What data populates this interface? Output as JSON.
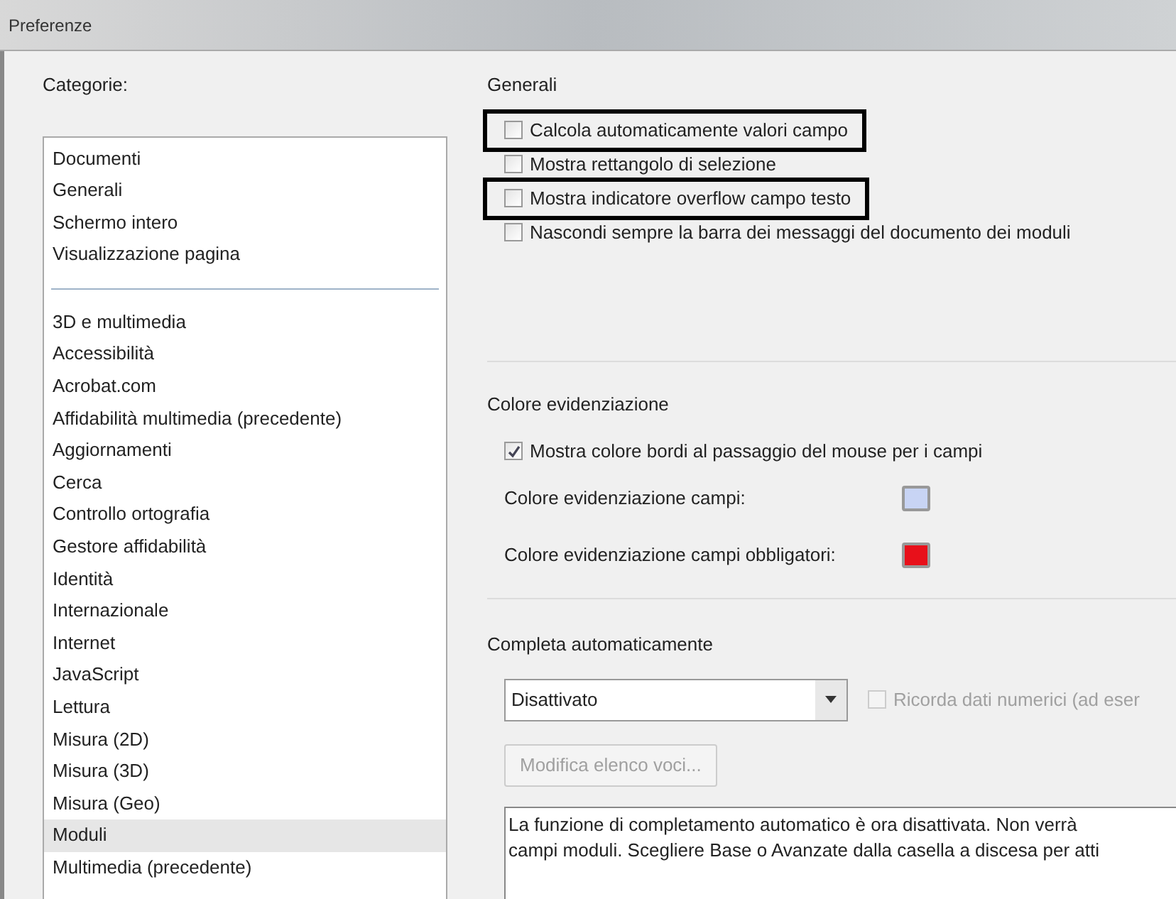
{
  "window": {
    "title": "Preferenze"
  },
  "categories": {
    "label": "Categorie:",
    "groups": [
      [
        {
          "label": "Documenti",
          "selected": false
        },
        {
          "label": "Generali",
          "selected": false
        },
        {
          "label": "Schermo intero",
          "selected": false
        },
        {
          "label": "Visualizzazione pagina",
          "selected": false
        }
      ],
      [
        {
          "label": "3D e multimedia",
          "selected": false
        },
        {
          "label": "Accessibilità",
          "selected": false
        },
        {
          "label": "Acrobat.com",
          "selected": false
        },
        {
          "label": "Affidabilità multimedia (precedente)",
          "selected": false
        },
        {
          "label": "Aggiornamenti",
          "selected": false
        },
        {
          "label": "Cerca",
          "selected": false
        },
        {
          "label": "Controllo ortografia",
          "selected": false
        },
        {
          "label": "Gestore affidabilità",
          "selected": false
        },
        {
          "label": "Identità",
          "selected": false
        },
        {
          "label": "Internazionale",
          "selected": false
        },
        {
          "label": "Internet",
          "selected": false
        },
        {
          "label": "JavaScript",
          "selected": false
        },
        {
          "label": "Lettura",
          "selected": false
        },
        {
          "label": "Misura (2D)",
          "selected": false
        },
        {
          "label": "Misura (3D)",
          "selected": false
        },
        {
          "label": "Misura (Geo)",
          "selected": false
        },
        {
          "label": "Moduli",
          "selected": true
        },
        {
          "label": "Multimedia (precedente)",
          "selected": false
        }
      ]
    ]
  },
  "general": {
    "title": "Generali",
    "options": [
      {
        "label": "Calcola automaticamente valori campo",
        "checked": false,
        "highlighted": true
      },
      {
        "label": "Mostra rettangolo di selezione",
        "checked": false,
        "highlighted": false
      },
      {
        "label": "Mostra indicatore overflow campo testo",
        "checked": false,
        "highlighted": true
      },
      {
        "label": "Nascondi sempre la barra dei messaggi del documento dei moduli",
        "checked": false,
        "highlighted": false
      }
    ]
  },
  "highlight": {
    "title": "Colore evidenziazione",
    "option": {
      "label": "Mostra colore bordi al passaggio del mouse per i campi",
      "checked": true
    },
    "colors": [
      {
        "label": "Colore evidenziazione campi:",
        "color": "#c8d4f4"
      },
      {
        "label": "Colore evidenziazione campi obbligatori:",
        "color": "#e8101a"
      }
    ]
  },
  "autocomplete": {
    "title": "Completa automaticamente",
    "dropdown": {
      "value": "Disattivato"
    },
    "remember_numbers": {
      "label": "Ricorda dati numerici (ad eser",
      "checked": false,
      "disabled": true
    },
    "edit_button": {
      "label": "Modifica elenco voci...",
      "disabled": true
    },
    "description": [
      "La funzione di completamento automatico è ora disattivata. Non verrà",
      "campi moduli. Scegliere Base o Avanzate dalla casella a discesa per atti"
    ]
  }
}
